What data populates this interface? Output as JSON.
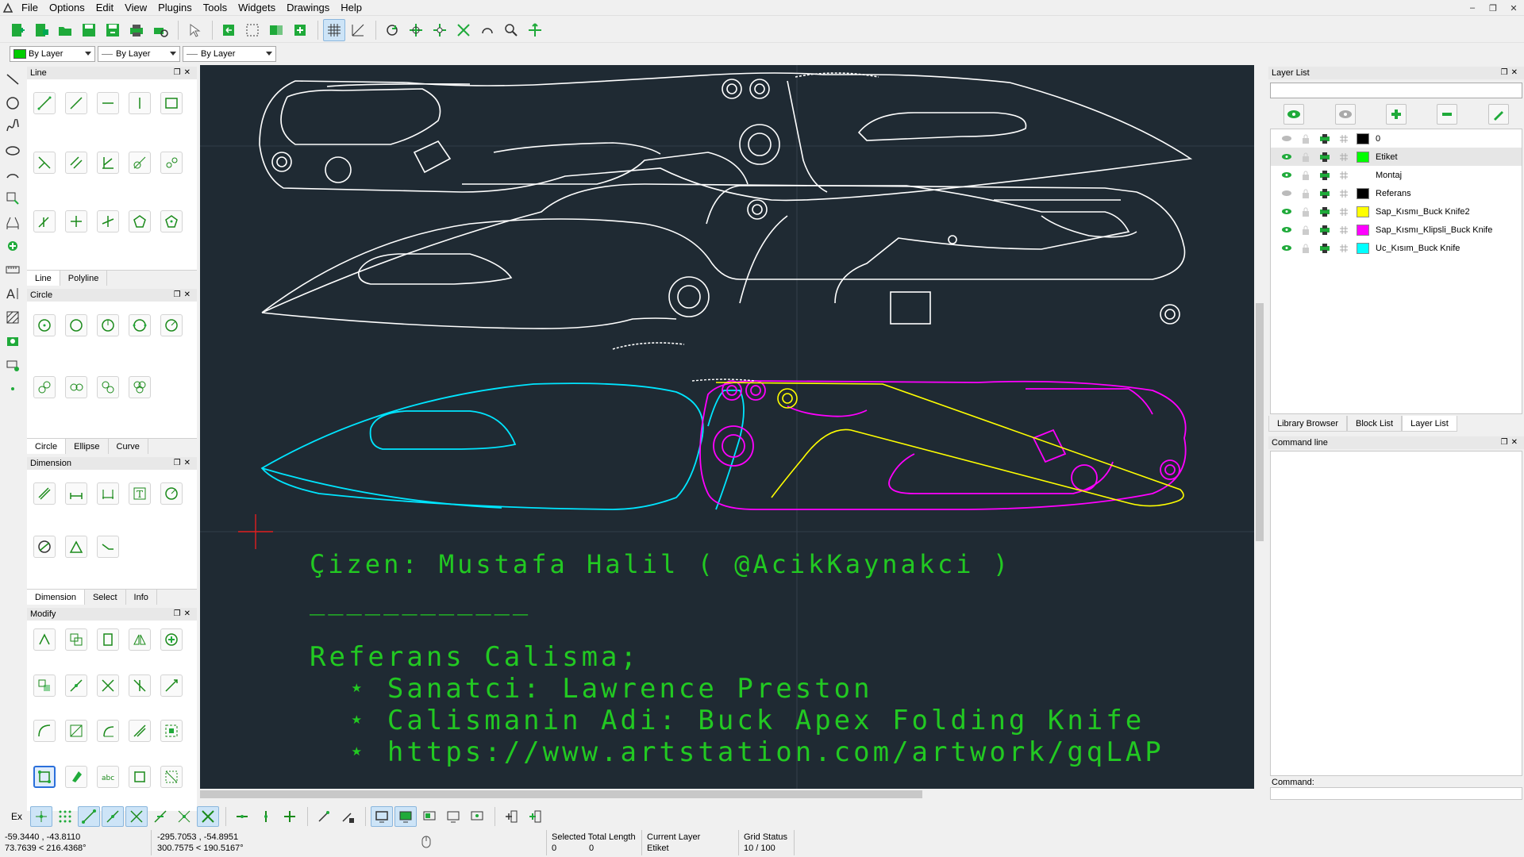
{
  "menu": [
    "File",
    "Options",
    "Edit",
    "View",
    "Plugins",
    "Tools",
    "Widgets",
    "Drawings",
    "Help"
  ],
  "toolbar": {
    "pen_color": "By Layer",
    "pen_width": "By Layer",
    "pen_type": "By Layer"
  },
  "left_dock": {
    "line_panel": {
      "title": "Line",
      "tabs": [
        "Line",
        "Polyline"
      ],
      "active_tab": "Line"
    },
    "circle_panel": {
      "title": "Circle",
      "tabs": [
        "Circle",
        "Ellipse",
        "Curve"
      ],
      "active_tab": "Circle"
    },
    "dimension_panel": {
      "title": "Dimension",
      "tabs": [
        "Dimension",
        "Select",
        "Info"
      ],
      "active_tab": "Dimension"
    },
    "modify_panel": {
      "title": "Modify"
    }
  },
  "drawing": {
    "credit": "Çizen: Mustafa Halil ( @AcikKaynakci )",
    "underline": "____________",
    "ref_title": "Referans Calisma;",
    "artist": "  ⋆ Sanatci: Lawrence Preston",
    "work_name": "  ⋆ Calismanin Adi: Buck Apex Folding Knife",
    "url": "  ⋆ https://www.artstation.com/artwork/gqLAP",
    "colors": {
      "background": "#1f2a33",
      "outline": "#ffffff",
      "blade": "#00e5ff",
      "handle_clip": "#ff00ff",
      "handle2": "#ffff00",
      "text": "#22c922",
      "cursor": "#e02020"
    }
  },
  "right_dock": {
    "layer_list_title": "Layer List",
    "layers": [
      {
        "name": "0",
        "color": "#000000",
        "visible": false
      },
      {
        "name": "Etiket",
        "color": "#00ff00",
        "visible": true,
        "selected": true
      },
      {
        "name": "Montaj",
        "color": "#ffffff",
        "visible": true
      },
      {
        "name": "Referans",
        "color": "#000000",
        "visible": false
      },
      {
        "name": "Sap_Kısmı_Buck Knife2",
        "color": "#ffff00",
        "visible": true
      },
      {
        "name": "Sap_Kısmı_Klipsli_Buck Knife",
        "color": "#ff00ff",
        "visible": true
      },
      {
        "name": "Uc_Kısım_Buck Knife",
        "color": "#00ffff",
        "visible": true
      }
    ],
    "tabs": [
      "Library Browser",
      "Block List",
      "Layer List"
    ],
    "active_tab": "Layer List",
    "command_line_title": "Command line",
    "command_label": "Command:"
  },
  "status": {
    "abs_xy": "-59.3440 , -43.8110",
    "abs_polar": "73.7639 < 216.4368°",
    "rel_xy": "-295.7053 , -54.8951",
    "rel_polar": "300.7575 < 190.5167°",
    "selected_label": "Selected Total Length",
    "selected_count": "0",
    "selected_length": "0",
    "current_layer_label": "Current Layer",
    "current_layer": "Etiket",
    "grid_label": "Grid Status",
    "grid_value": "10 / 100"
  },
  "snap": {
    "ex_label": "Ex"
  }
}
